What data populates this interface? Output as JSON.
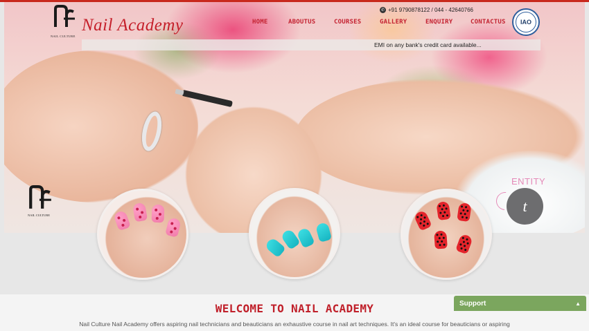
{
  "header": {
    "brand": "Nail Academy",
    "logo_tagline": "NAIL CULTURE",
    "phone": "+91 9790878122 / 044 - 42640766",
    "badge": "IAO"
  },
  "nav": {
    "items": [
      "HOME",
      "ABOUTUS",
      "COURSES",
      "GALLERY",
      "ENQUIRY",
      "CONTACTUS"
    ]
  },
  "banner": {
    "emi_text": "EMI on any bank's credit card available...",
    "watermark_tagline": "NAIL CULTURE",
    "entity_label": "ENTITY",
    "entity_monogram": "t"
  },
  "welcome": {
    "title": "WELCOME TO NAIL ACADEMY",
    "body": "Nail Culture Nail Academy offers aspiring nail technicians and beauticians an exhaustive course in nail art techniques. It's an ideal course for beauticians or aspiring"
  },
  "support": {
    "label": "Support",
    "icon": "chevron-up-icon"
  },
  "colors": {
    "accent_red": "#c42332",
    "support_green": "#7ba65e",
    "entity_pink": "#e58ab8"
  }
}
